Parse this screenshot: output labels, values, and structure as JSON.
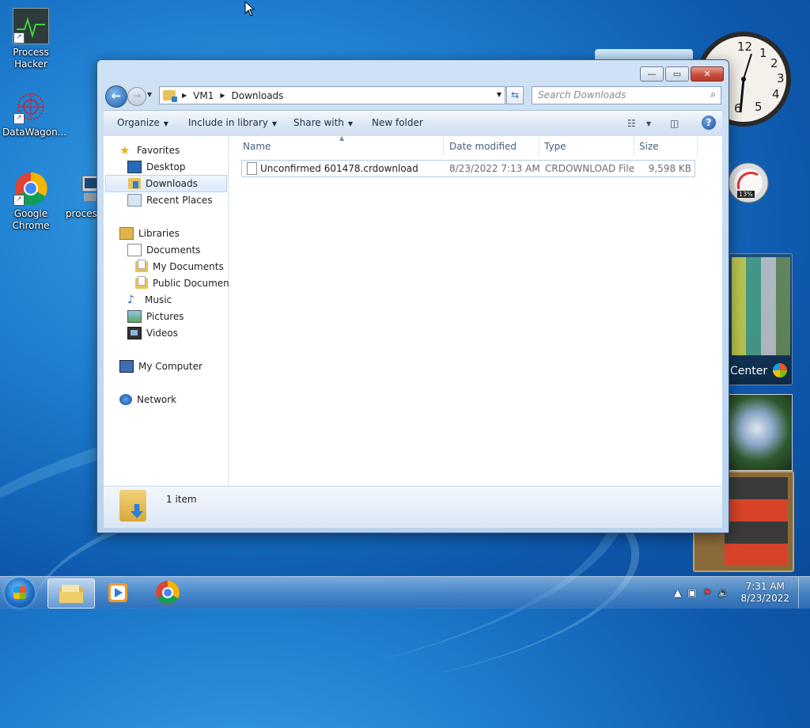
{
  "desktop": {
    "icons": [
      {
        "label": "Process Hacker"
      },
      {
        "label": "DataWagon..."
      },
      {
        "label": "Google Chrome"
      },
      {
        "label": "process"
      }
    ],
    "gadgets": {
      "clock_numbers": [
        "12",
        "1",
        "2",
        "3",
        "4",
        "5",
        "6"
      ],
      "cpu_percent": "13%",
      "media_center_label": "Center"
    }
  },
  "window": {
    "address": {
      "crumbs": [
        "VM1",
        "Downloads"
      ]
    },
    "search": {
      "placeholder": "Search Downloads"
    },
    "toolbar": {
      "organize": "Organize",
      "include_in_library": "Include in library",
      "share_with": "Share with",
      "new_folder": "New folder"
    },
    "nav": {
      "favorites": "Favorites",
      "desktop": "Desktop",
      "downloads": "Downloads",
      "recent_places": "Recent Places",
      "libraries": "Libraries",
      "documents": "Documents",
      "my_documents": "My Documents",
      "public_documents": "Public Documents",
      "music": "Music",
      "pictures": "Pictures",
      "videos": "Videos",
      "my_computer": "My Computer",
      "network": "Network"
    },
    "columns": {
      "name": "Name",
      "date_modified": "Date modified",
      "type": "Type",
      "size": "Size"
    },
    "files": [
      {
        "name": "Unconfirmed 601478.crdownload",
        "date_modified": "8/23/2022 7:13 AM",
        "type": "CRDOWNLOAD File",
        "size": "9,598 KB"
      }
    ],
    "details": {
      "item_count": "1 item"
    }
  },
  "taskbar": {
    "time": "7:31 AM",
    "date": "8/23/2022"
  }
}
